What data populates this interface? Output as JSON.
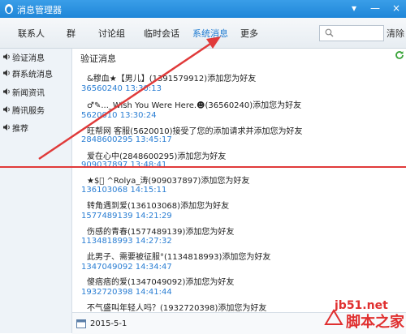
{
  "window": {
    "title": "消息管理器",
    "min": "▾",
    "minimize": "—",
    "close": "×"
  },
  "tabs": [
    "联系人",
    "群",
    "讨论组",
    "临时会话",
    "系统消息",
    "更多"
  ],
  "active_tab": "系统消息",
  "toolbar": {
    "search_placeholder": "",
    "clear_label": "清除"
  },
  "sidebar": {
    "items": [
      "验证消息",
      "群系统消息",
      "新闻资讯",
      "腾讯服务",
      "推荐"
    ]
  },
  "main": {
    "header": "验证消息",
    "messages": [
      {
        "text": "&穆血★【男儿】(1391579912)添加您为好友",
        "meta": "36560240 13:30:13"
      },
      {
        "text": "♂✎..._Wish You Were Here.☻(36560240)添加您为好友",
        "meta": "5620010 13:30:24"
      },
      {
        "text": "旺帮网 客服(5620010)接受了您的添加请求并添加您为好友",
        "meta": "2848600295 13:45:17"
      },
      {
        "text": "爱在心中(2848600295)添加您为好友",
        "meta": "909037897 13:48:41"
      },
      {
        "text": "★$⃝ ^Rolya_涛(909037897)添加您为好友",
        "meta": "136103068 14:15:11"
      },
      {
        "text": "转角遇到爱(136103068)添加您为好友",
        "meta": "1577489139 14:21:29"
      },
      {
        "text": "伤感的青春(1577489139)添加您为好友",
        "meta": "1134818993 14:27:32"
      },
      {
        "text": "此男子、需要被征服°(1134818993)添加您为好友",
        "meta": "1347049092 14:34:47"
      },
      {
        "text": "傻痞痞的爱(1347049092)添加您为好友",
        "meta": "1932720398 14:41:44"
      },
      {
        "text": "不气盛叫年轻人吗？(1932720398)添加您为好友",
        "meta": ""
      }
    ],
    "footer_date": "2015-5-1"
  },
  "watermark": {
    "site": "jb51.net",
    "name": "脚本之家"
  },
  "colors": {
    "titlebar": "#1f86d8",
    "accent": "#2a7ed3",
    "annotation": "#e03a3a"
  },
  "icons": {
    "app": "qq-penguin-icon",
    "search": "search-icon",
    "refresh": "refresh-icon",
    "speaker": "speaker-icon",
    "calendar": "calendar-icon"
  }
}
